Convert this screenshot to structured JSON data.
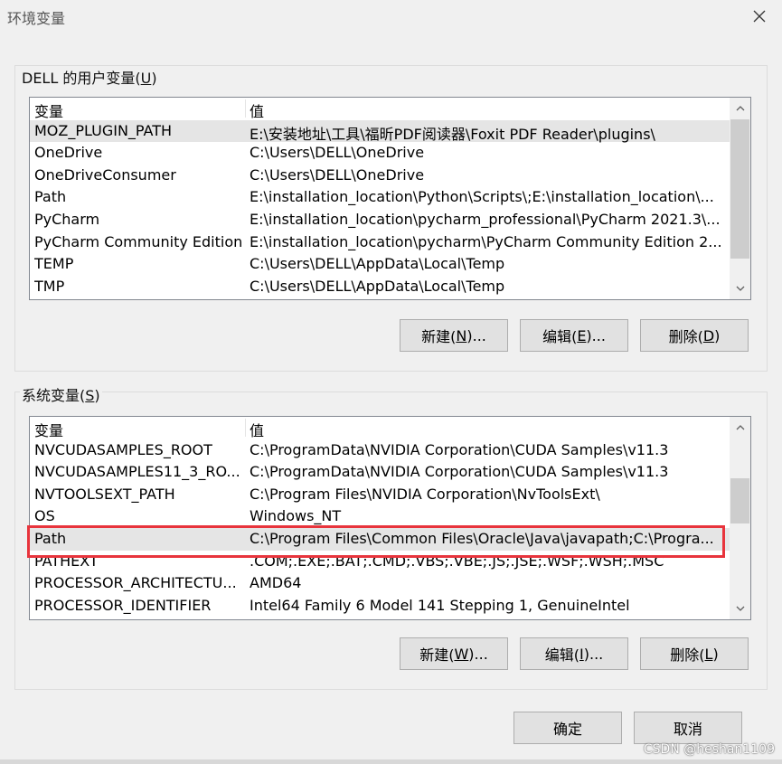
{
  "window": {
    "title": "环境变量",
    "close_icon": "close-icon"
  },
  "user_vars": {
    "group_label": "DELL 的用户变量",
    "group_label_key": "U",
    "columns": [
      "变量",
      "值"
    ],
    "rows": [
      {
        "name": "MOZ_PLUGIN_PATH",
        "value": "E:\\安装地址\\工具\\福昕PDF阅读器\\Foxit PDF Reader\\plugins\\"
      },
      {
        "name": "OneDrive",
        "value": "C:\\Users\\DELL\\OneDrive"
      },
      {
        "name": "OneDriveConsumer",
        "value": "C:\\Users\\DELL\\OneDrive"
      },
      {
        "name": "Path",
        "value": "E:\\installation_location\\Python\\Scripts\\;E:\\installation_location\\..."
      },
      {
        "name": "PyCharm",
        "value": "E:\\installation_location\\pycharm_professional\\PyCharm 2021.3\\..."
      },
      {
        "name": "PyCharm Community Edition",
        "value": "E:\\installation_location\\pycharm\\PyCharm Community Edition 2..."
      },
      {
        "name": "TEMP",
        "value": "C:\\Users\\DELL\\AppData\\Local\\Temp"
      },
      {
        "name": "TMP",
        "value": "C:\\Users\\DELL\\AppData\\Local\\Temp"
      }
    ],
    "buttons": {
      "new": {
        "text": "新建(",
        "key": "N",
        "suffix": ")..."
      },
      "edit": {
        "text": "编辑(",
        "key": "E",
        "suffix": ")..."
      },
      "delete": {
        "text": "删除(",
        "key": "D",
        "suffix": ")"
      }
    }
  },
  "system_vars": {
    "group_label": "系统变量",
    "group_label_key": "S",
    "columns": [
      "变量",
      "值"
    ],
    "rows": [
      {
        "name": "NVCUDASAMPLES_ROOT",
        "value": "C:\\ProgramData\\NVIDIA Corporation\\CUDA Samples\\v11.3"
      },
      {
        "name": "NVCUDASAMPLES11_3_RO...",
        "value": "C:\\ProgramData\\NVIDIA Corporation\\CUDA Samples\\v11.3"
      },
      {
        "name": "NVTOOLSEXT_PATH",
        "value": "C:\\Program Files\\NVIDIA Corporation\\NvToolsExt\\"
      },
      {
        "name": "OS",
        "value": "Windows_NT"
      },
      {
        "name": "Path",
        "value": "C:\\Program Files\\Common Files\\Oracle\\Java\\javapath;C:\\Progra..."
      },
      {
        "name": "PATHEXT",
        "value": ".COM;.EXE;.BAT;.CMD;.VBS;.VBE;.JS;.JSE;.WSF;.WSH;.MSC"
      },
      {
        "name": "PROCESSOR_ARCHITECTU...",
        "value": "AMD64"
      },
      {
        "name": "PROCESSOR_IDENTIFIER",
        "value": "Intel64 Family 6 Model 141 Stepping 1, GenuineIntel"
      }
    ],
    "buttons": {
      "new": {
        "text": "新建(",
        "key": "W",
        "suffix": ")..."
      },
      "edit": {
        "text": "编辑(",
        "key": "I",
        "suffix": ")..."
      },
      "delete": {
        "text": "删除(",
        "key": "L",
        "suffix": ")"
      }
    }
  },
  "dialog_buttons": {
    "ok": "确定",
    "cancel": "取消"
  },
  "watermark": "CSDN @heshan1109",
  "colors": {
    "highlight": "#e8343c",
    "selection": "#e5e5e5"
  }
}
